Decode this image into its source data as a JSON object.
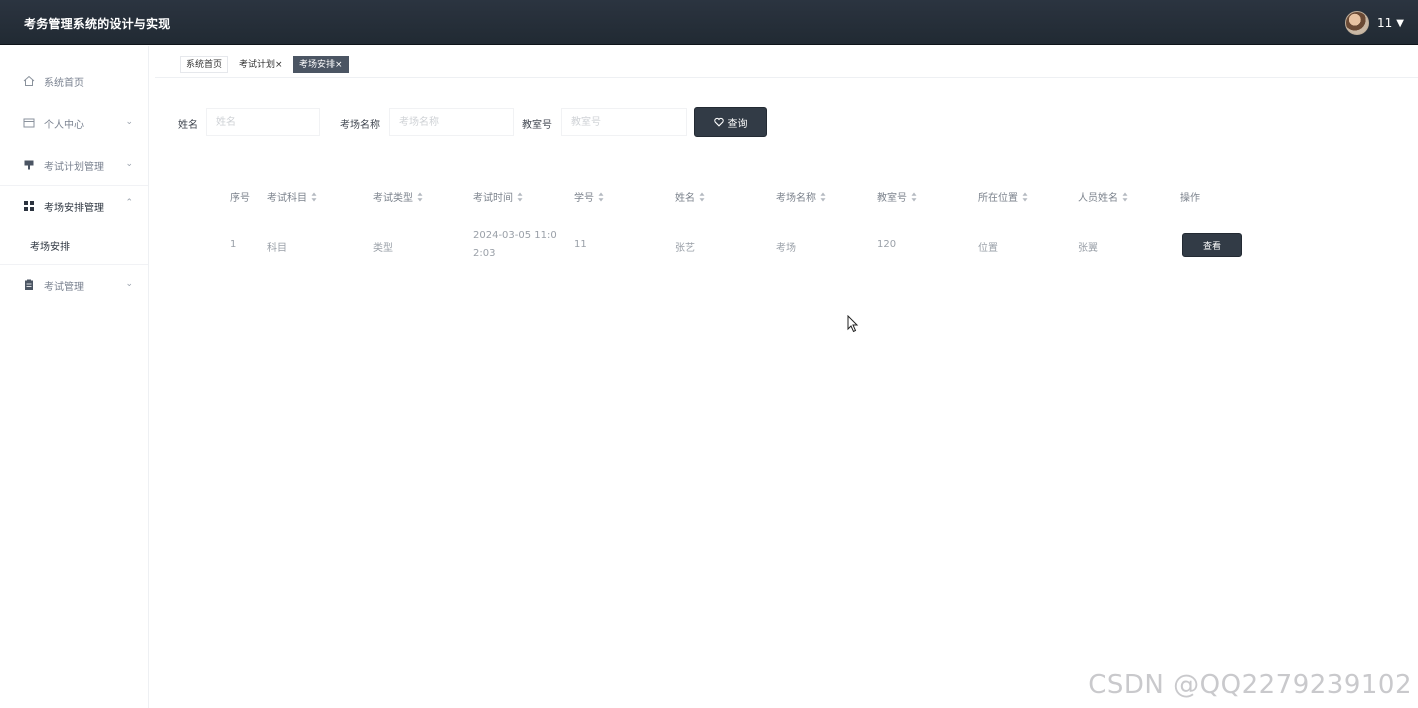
{
  "header": {
    "title": "考务管理系统的设计与实现",
    "username": "11"
  },
  "sidebar": {
    "items": [
      {
        "label": "系统首页",
        "icon": "home-icon"
      },
      {
        "label": "个人中心",
        "icon": "card-icon"
      },
      {
        "label": "考试计划管理",
        "icon": "flag-icon"
      },
      {
        "label": "考场安排管理",
        "icon": "grid-icon"
      },
      {
        "label": "考试管理",
        "icon": "clipboard-icon"
      }
    ],
    "submenu": {
      "label": "考场安排"
    }
  },
  "tabs": [
    {
      "label": "系统首页"
    },
    {
      "label": "考试计划",
      "close": "×"
    },
    {
      "label": "考场安排",
      "close": "×"
    }
  ],
  "search": {
    "name_label": "姓名",
    "name_placeholder": "姓名",
    "room_name_label": "考场名称",
    "room_name_placeholder": "考场名称",
    "room_no_label": "教室号",
    "room_no_placeholder": "教室号",
    "button_label": "查询"
  },
  "table": {
    "headers": [
      "序号",
      "考试科目",
      "考试类型",
      "考试时间",
      "学号",
      "姓名",
      "考场名称",
      "教室号",
      "所在位置",
      "人员姓名",
      "操作"
    ],
    "rows": [
      {
        "index": "1",
        "subject": "科目",
        "type": "类型",
        "time": "2024-03-05 11:02:03",
        "student_no": "11",
        "name": "张艺",
        "room_name": "考场",
        "room_no": "120",
        "location": "位置",
        "staff": "张翼",
        "action": "查看"
      }
    ]
  },
  "watermark": "CSDN @QQ2279239102"
}
